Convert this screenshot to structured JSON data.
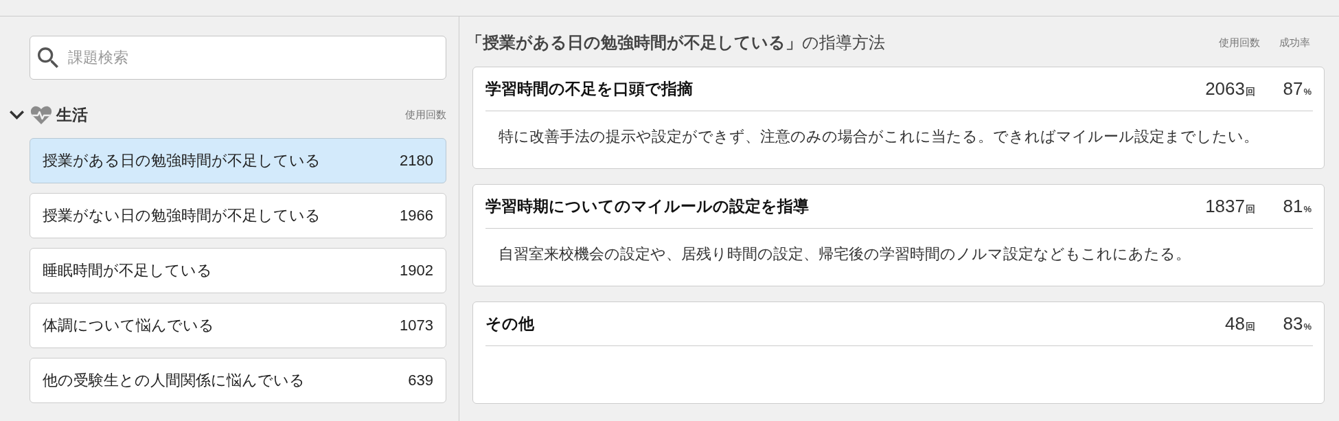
{
  "search": {
    "placeholder": "課題検索"
  },
  "category": {
    "label": "生活",
    "expanded": true,
    "column_label": "使用回数"
  },
  "issues": [
    {
      "label": "授業がある日の勉強時間が不足している",
      "count": "2180",
      "selected": true
    },
    {
      "label": "授業がない日の勉強時間が不足している",
      "count": "1966",
      "selected": false
    },
    {
      "label": "睡眠時間が不足している",
      "count": "1902",
      "selected": false
    },
    {
      "label": "体調について悩んでいる",
      "count": "1073",
      "selected": false
    },
    {
      "label": "他の受験生との人間関係に悩んでいる",
      "count": "639",
      "selected": false
    }
  ],
  "methods_panel": {
    "title": "**「授業がある日の勉強時間が不足している」**の指導方法",
    "columns": [
      "使用回数",
      "成功率"
    ]
  },
  "methods": [
    {
      "title": "学習時間の不足を口頭で指摘",
      "count": "2063",
      "count_unit": "回",
      "rate": "87",
      "rate_unit": "%",
      "description": "特に改善手法の提示や設定ができず、注意のみの場合がこれに当たる。できればマイルール設定までしたい。"
    },
    {
      "title": "学習時期についてのマイルールの設定を指導",
      "count": "1837",
      "count_unit": "回",
      "rate": "81",
      "rate_unit": "%",
      "description": "自習室来校機会の設定や、居残り時間の設定、帰宅後の学習時間のノルマ設定などもこれにあたる。"
    },
    {
      "title": "その他",
      "count": "48",
      "count_unit": "回",
      "rate": "83",
      "rate_unit": "%"
    }
  ]
}
